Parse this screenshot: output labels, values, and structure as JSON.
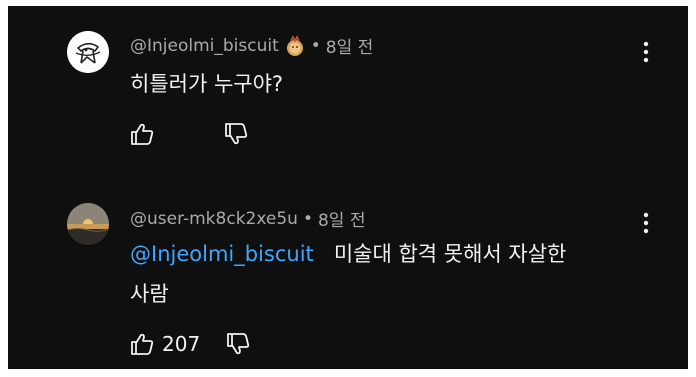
{
  "comments": [
    {
      "handle": "@Injeolmi_biscuit",
      "badge_icon": "cookie-icon",
      "time": "8일 전",
      "text": "히틀러가 누구야?",
      "like_count": ""
    },
    {
      "handle": "@user-mk8ck2xe5u",
      "time": "8일 전",
      "mention": "@Injeolmi_biscuit",
      "text_line1": "미술대 합격 못해서 자살한",
      "text_line2": "사람",
      "like_count": "207"
    }
  ],
  "separator": "•",
  "colors": {
    "background": "#0f0f0f",
    "text": "#f1f1f1",
    "meta": "#aaaaaa",
    "mention": "#3ea6ff"
  }
}
